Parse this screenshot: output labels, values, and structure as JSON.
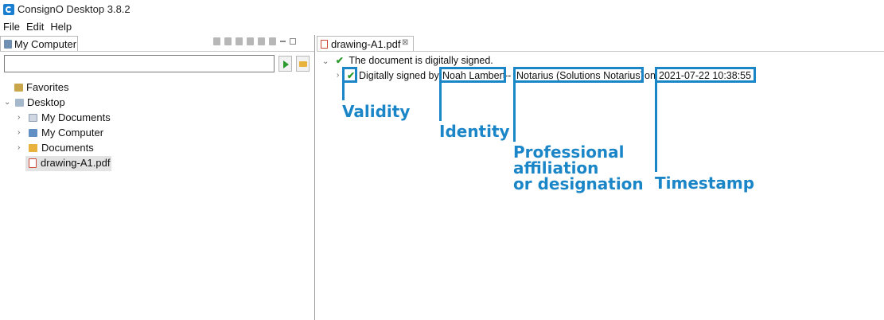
{
  "window": {
    "title": "ConsignO Desktop 3.8.2"
  },
  "menu": {
    "items": [
      "File",
      "Edit",
      "Help"
    ]
  },
  "left_panel": {
    "tab_label": "My Computer",
    "search": {
      "value": "",
      "placeholder": ""
    },
    "tree": {
      "favorites": "Favorites",
      "desktop": "Desktop",
      "my_documents": "My Documents",
      "my_computer": "My Computer",
      "documents": "Documents",
      "file": "drawing-A1.pdf"
    }
  },
  "right_panel": {
    "tab_label": "drawing-A1.pdf",
    "tab_close": "⊠",
    "status_line": "The document is digitally signed.",
    "signature": {
      "prefix": "Digitally signed by",
      "signer": "Noah Lambert",
      "separator": "--",
      "affiliation": "Notarius (Solutions Notarius)",
      "on": "on",
      "timestamp": "2021-07-22 10:38:55"
    }
  },
  "annotations": {
    "validity": "Validity",
    "identity": "Identity",
    "affiliation": "Professional\naffiliation\nor designation",
    "timestamp": "Timestamp"
  },
  "colors": {
    "annotation": "#1a86c8",
    "check": "#2c9a2c",
    "app_icon": "#1a7fd0"
  }
}
